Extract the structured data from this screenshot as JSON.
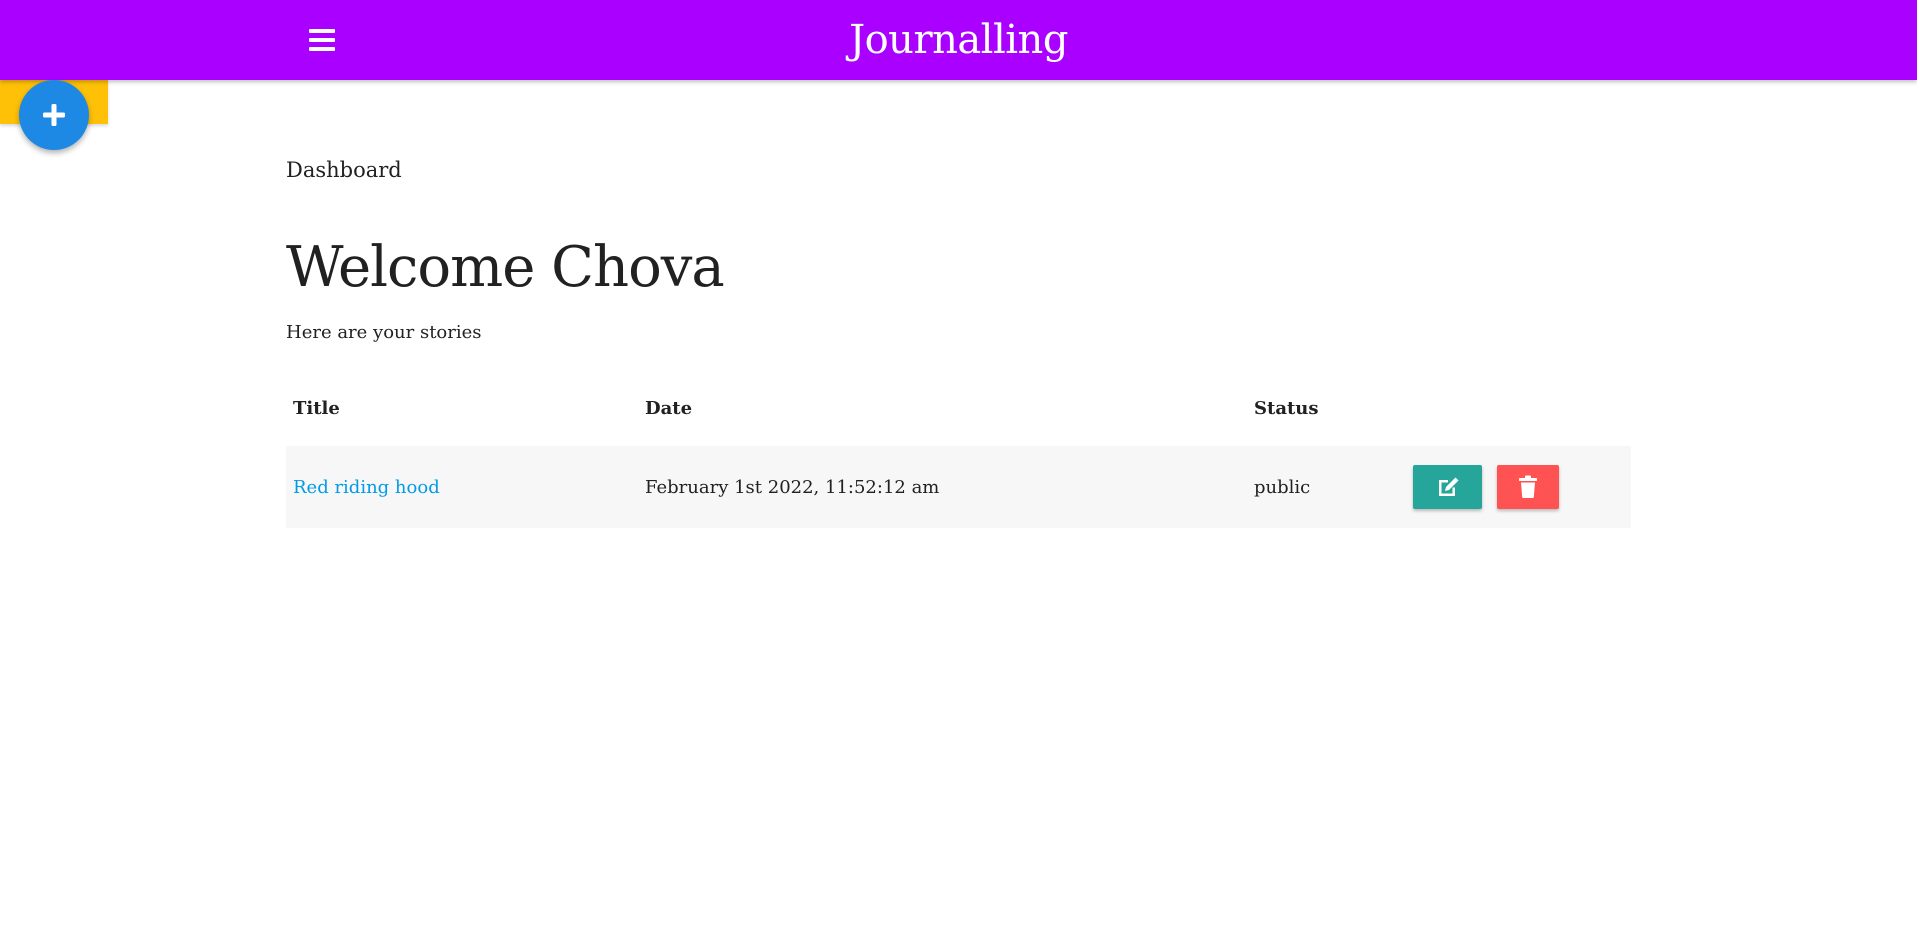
{
  "app": {
    "brand": "Journalling"
  },
  "colors": {
    "navbar": "#aa00ff",
    "fab": "#1e88e5",
    "fab_strip": "#ffc107",
    "edit_button": "#26a69a",
    "delete_button": "#ff5252",
    "link": "#039be5"
  },
  "icons": {
    "menu": "hamburger-icon",
    "add": "plus-icon",
    "edit": "edit-icon",
    "delete": "trash-icon"
  },
  "main": {
    "breadcrumb": "Dashboard",
    "welcome": "Welcome Chova",
    "subtitle": "Here are your stories",
    "table": {
      "headers": [
        "Title",
        "Date",
        "Status"
      ],
      "rows": [
        {
          "title": "Red riding hood",
          "date": "February 1st 2022, 11:52:12 am",
          "status": "public"
        }
      ]
    }
  }
}
